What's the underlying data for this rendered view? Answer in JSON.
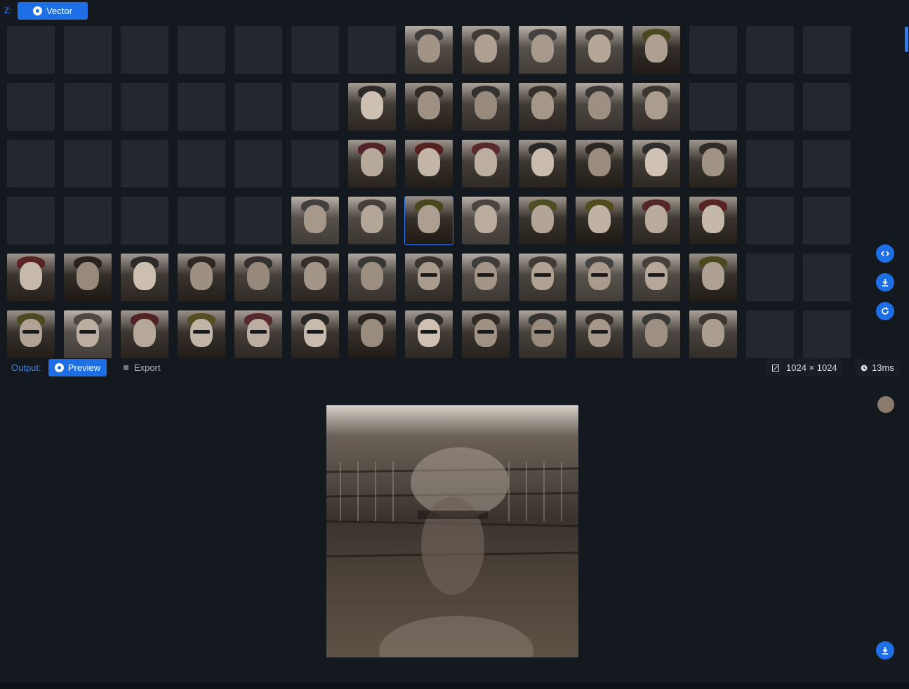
{
  "topbar": {
    "z_label": "Z:",
    "vector_label": "Vector"
  },
  "grid": {
    "rows": 6,
    "cols": 15,
    "filled": [
      [
        0,
        7
      ],
      [
        0,
        8
      ],
      [
        0,
        9
      ],
      [
        0,
        10
      ],
      [
        0,
        11
      ],
      [
        1,
        6
      ],
      [
        1,
        7
      ],
      [
        1,
        8
      ],
      [
        1,
        9
      ],
      [
        1,
        10
      ],
      [
        1,
        11
      ],
      [
        2,
        6
      ],
      [
        2,
        7
      ],
      [
        2,
        8
      ],
      [
        2,
        9
      ],
      [
        2,
        10
      ],
      [
        2,
        11
      ],
      [
        2,
        12
      ],
      [
        3,
        5
      ],
      [
        3,
        6
      ],
      [
        3,
        7
      ],
      [
        3,
        8
      ],
      [
        3,
        9
      ],
      [
        3,
        10
      ],
      [
        3,
        11
      ],
      [
        3,
        12
      ],
      [
        4,
        0
      ],
      [
        4,
        1
      ],
      [
        4,
        2
      ],
      [
        4,
        3
      ],
      [
        4,
        4
      ],
      [
        4,
        5
      ],
      [
        4,
        6
      ],
      [
        4,
        7
      ],
      [
        4,
        8
      ],
      [
        4,
        9
      ],
      [
        4,
        10
      ],
      [
        4,
        11
      ],
      [
        4,
        12
      ],
      [
        5,
        0
      ],
      [
        5,
        1
      ],
      [
        5,
        2
      ],
      [
        5,
        3
      ],
      [
        5,
        4
      ],
      [
        5,
        5
      ],
      [
        5,
        6
      ],
      [
        5,
        7
      ],
      [
        5,
        8
      ],
      [
        5,
        9
      ],
      [
        5,
        10
      ],
      [
        5,
        11
      ],
      [
        5,
        12
      ]
    ],
    "selected": [
      3,
      7
    ],
    "sunglasses": [
      [
        4,
        7
      ],
      [
        4,
        8
      ],
      [
        4,
        9
      ],
      [
        4,
        10
      ],
      [
        4,
        11
      ],
      [
        5,
        0
      ],
      [
        5,
        1
      ],
      [
        5,
        3
      ],
      [
        5,
        4
      ],
      [
        5,
        5
      ],
      [
        5,
        7
      ],
      [
        5,
        8
      ],
      [
        5,
        9
      ],
      [
        5,
        10
      ]
    ]
  },
  "side_actions": [
    {
      "name": "code-icon-button",
      "icon": "code-icon"
    },
    {
      "name": "download-icon-button",
      "icon": "download-icon"
    },
    {
      "name": "refresh-icon-button",
      "icon": "refresh-icon"
    }
  ],
  "output": {
    "label": "Output:",
    "preview_label": "Preview",
    "export_label": "Export",
    "dimensions": "1024 × 1024",
    "timing": "13ms"
  },
  "colors": {
    "accent": "#1e6fe6",
    "background": "#14181f",
    "empty_cell": "#23272f"
  }
}
